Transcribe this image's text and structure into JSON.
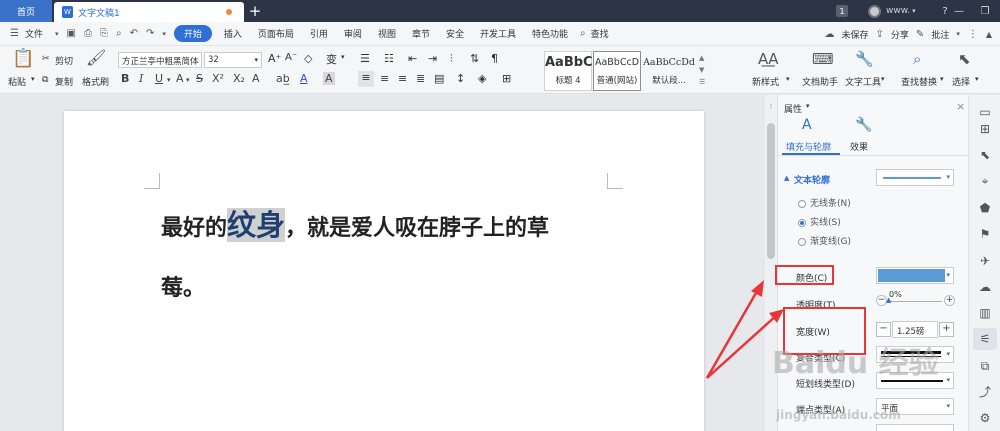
{
  "tabbar": {
    "home": "首页",
    "doc_title": "文字文稿1",
    "new_tab": "+",
    "page_count": "1",
    "user": "www.",
    "help": "?",
    "colors": {
      "bg": "#2c3446",
      "home": "#3a72c7",
      "unsaved_dot": "#f08b3c"
    }
  },
  "menu": {
    "file": "文件",
    "tabs": [
      "开始",
      "插入",
      "页面布局",
      "引用",
      "审阅",
      "视图",
      "章节",
      "安全",
      "开发工具",
      "特色功能"
    ],
    "active_tab": "开始",
    "search": "查找",
    "unsaved": "未保存",
    "share": "分享",
    "comment": "批注",
    "accent": "#2e6fd8"
  },
  "ribbon": {
    "cut": "剪切",
    "paste": "粘贴",
    "copy": "复制",
    "format_painter": "格式刷",
    "font_name": "方正兰亭中粗黑简体",
    "font_size": "32",
    "styles": [
      {
        "sample": "AaBbC",
        "name": "标题 4"
      },
      {
        "sample": "AaBbCcD",
        "name": "普通(网站)"
      },
      {
        "sample": "AaBbCcDd",
        "name": "默认段..."
      }
    ],
    "new_style": "新样式",
    "doc_assistant": "文档助手",
    "text_tools": "文字工具",
    "find_replace": "查找替换",
    "select": "选择"
  },
  "document": {
    "text_before": "最好的",
    "highlight": "纹身",
    "text_after": "，就是爱人吸在脖子上的草",
    "line2": "莓。"
  },
  "panel": {
    "title": "属性",
    "tab_fill": "填充与轮廓",
    "tab_effect": "效果",
    "section": "文本轮廓",
    "options": [
      "无线条(N)",
      "实线(S)",
      "渐变线(G)"
    ],
    "selected_option": "实线(S)",
    "color_label": "颜色(C)",
    "line_color": "#5b9bd5",
    "transparency_label": "透明度(T)",
    "transparency_value": "0%",
    "width_label": "宽度(W)",
    "width_value": "1.25磅",
    "compound_label": "复合类型(C)",
    "dash_label": "短划线类型(D)",
    "cap_label": "端点类型(A)",
    "cap_value": "平面"
  },
  "watermark": {
    "brand": "Baidu 经验",
    "url": "jingyan.baidu.com"
  },
  "annotation_color": "#e8353a"
}
